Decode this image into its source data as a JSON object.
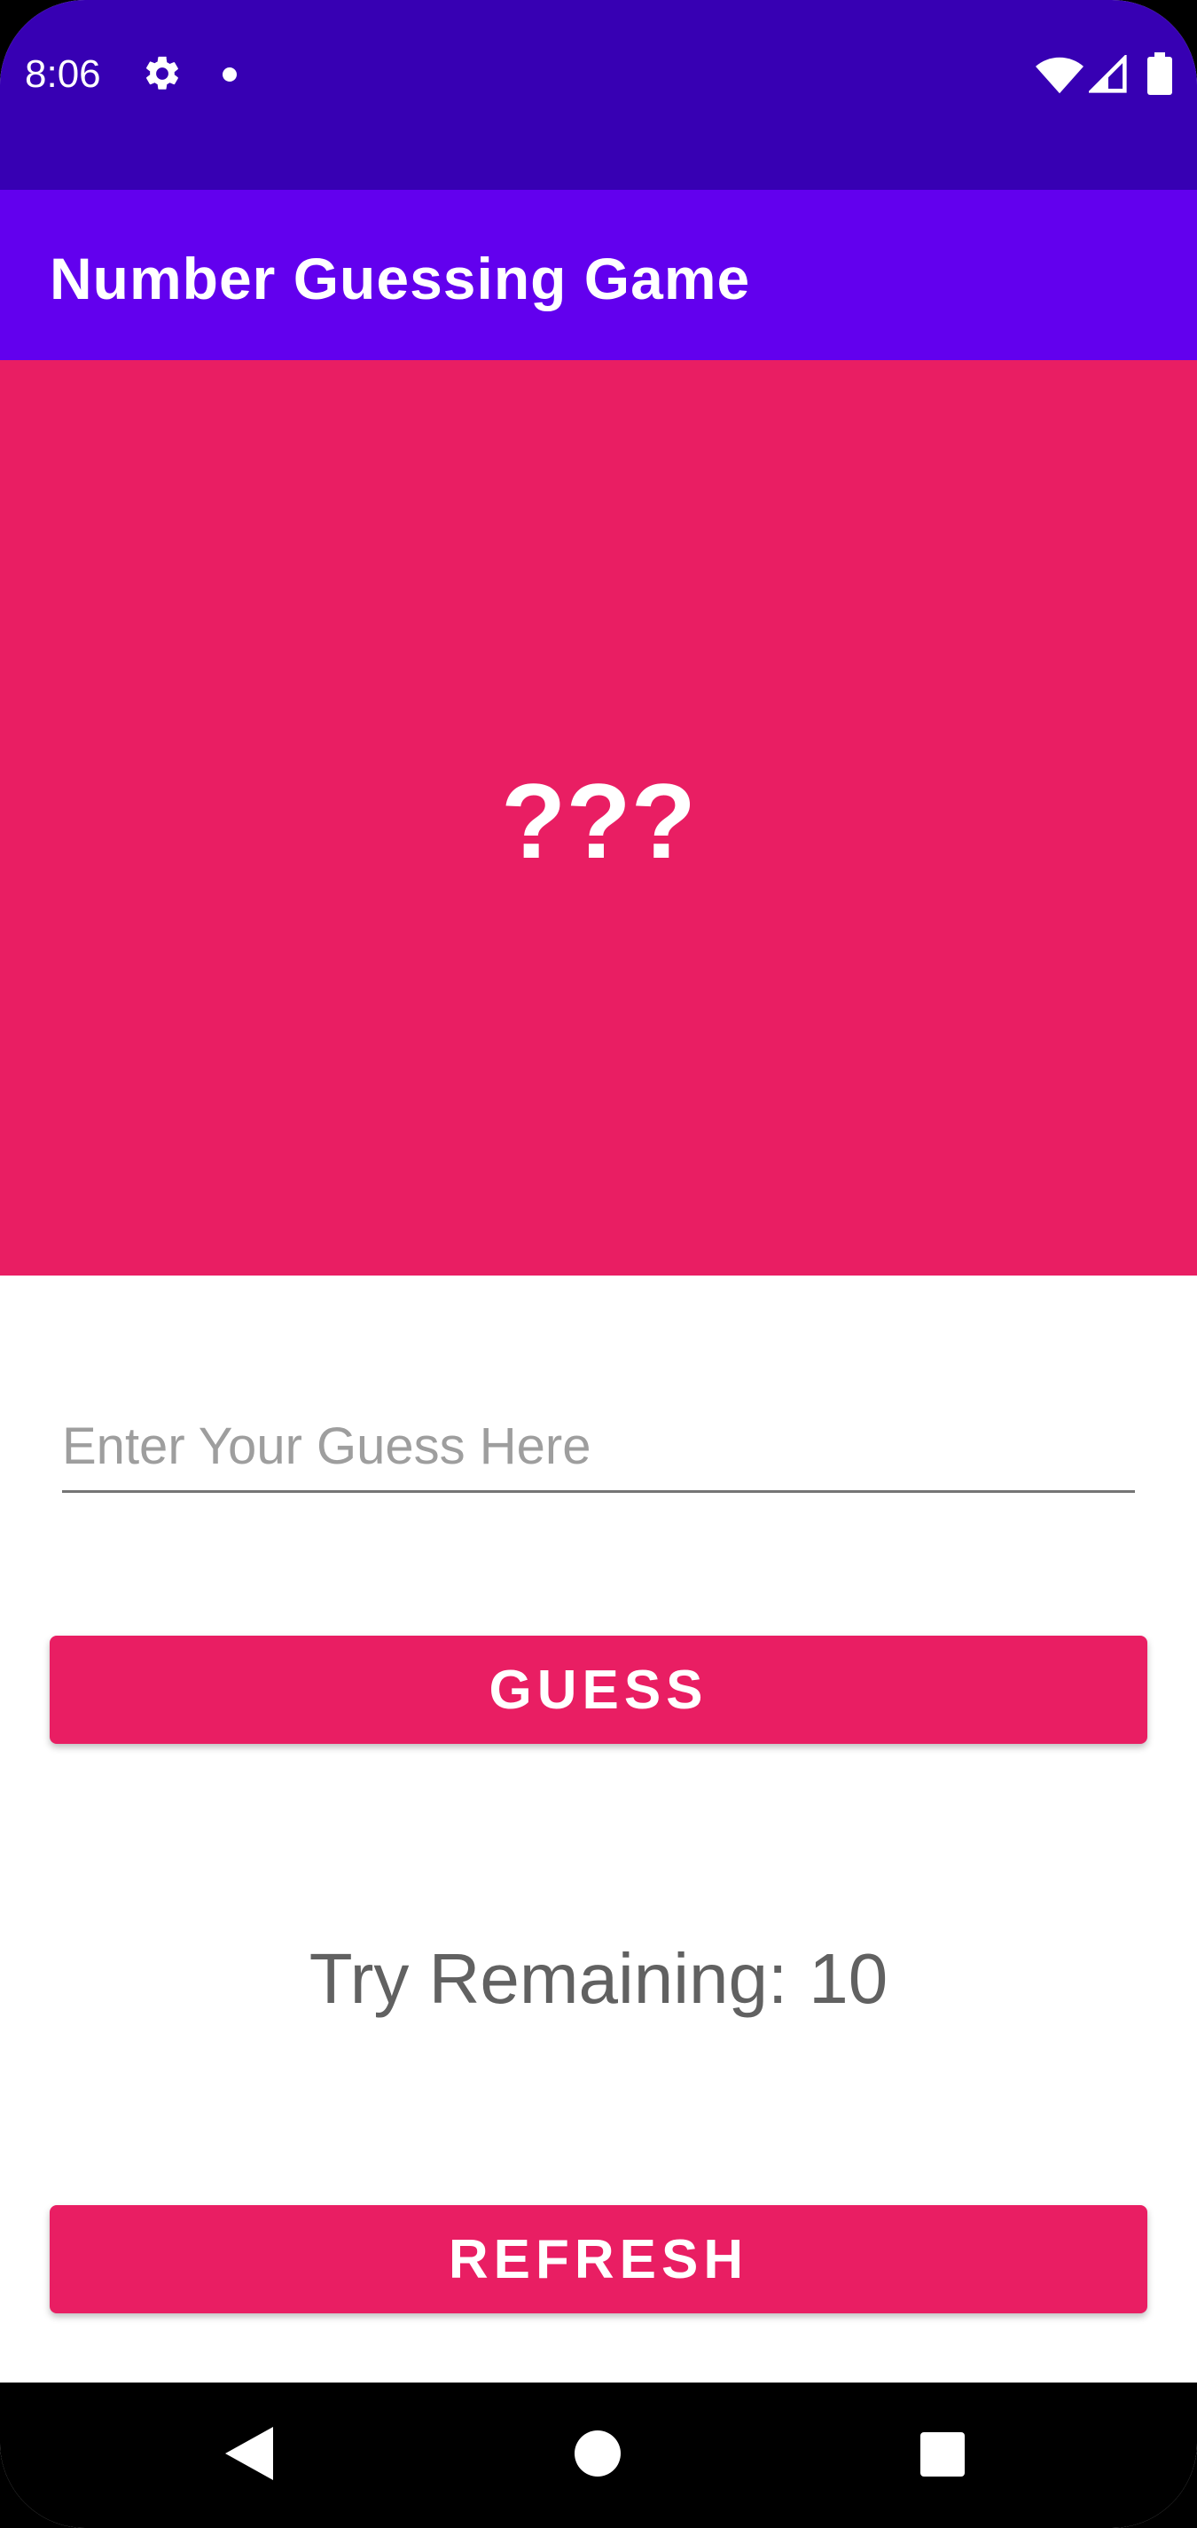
{
  "status_bar": {
    "time": "8:06",
    "icons": [
      "gear-icon",
      "notification-dot-icon",
      "wifi-icon",
      "cell-signal-icon",
      "battery-icon"
    ]
  },
  "app_bar": {
    "title": "Number Guessing Game"
  },
  "number_panel": {
    "hidden_number": "???"
  },
  "guess_input": {
    "value": "",
    "placeholder": "Enter Your Guess Here"
  },
  "guess_button": {
    "label": "GUESS"
  },
  "remaining": {
    "label": "Try Remaining:",
    "count": "10"
  },
  "refresh_button": {
    "label": "REFRESH"
  },
  "nav_bar": {
    "icons": [
      "back-icon",
      "home-icon",
      "recents-icon"
    ]
  },
  "colors": {
    "status_bar": "#3700b3",
    "app_bar": "#6200ee",
    "accent": "#e91e63",
    "text_secondary": "#616161"
  }
}
